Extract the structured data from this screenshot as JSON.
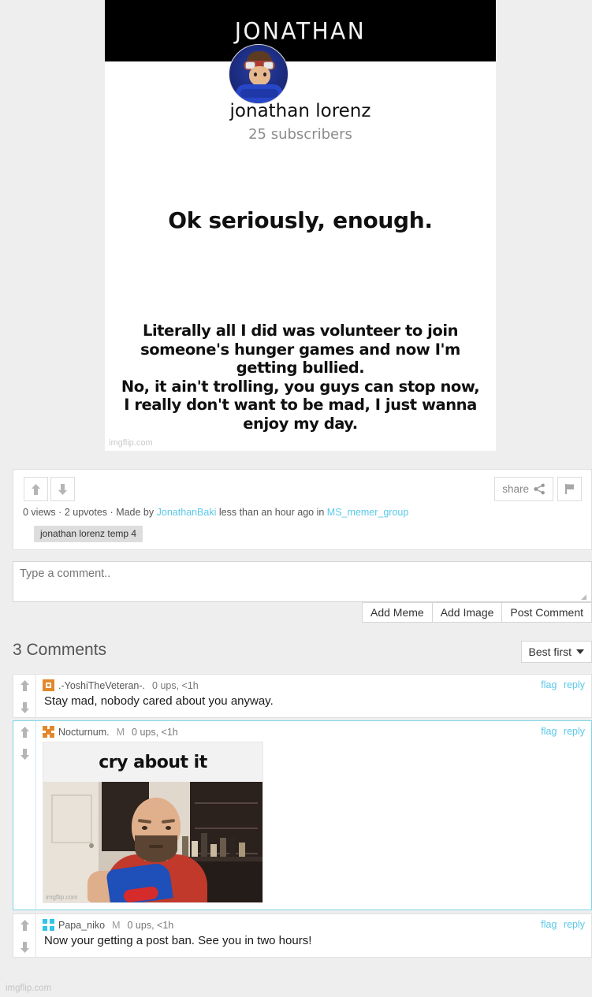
{
  "meme": {
    "banner_title": "JONATHAN",
    "channel_name": "jonathan lorenz",
    "subscribers": "25 subscribers",
    "headline": "Ok seriously, enough.",
    "body_line1": "Literally all I did was volunteer to join",
    "body_line2": "someone's hunger games and now I'm getting bullied.",
    "body_line3": "No, it ain't trolling, you guys can stop now,",
    "body_line4": "I really don't want to be mad, I just wanna enjoy my day.",
    "watermark": "imgflip.com"
  },
  "meta": {
    "views": "0 views",
    "sep1": "·",
    "upvotes": "2 upvotes",
    "sep2": "·",
    "made_by_label": "Made by",
    "author": "JonathanBaki",
    "time_text": "less than an hour ago in",
    "stream": "MS_memer_group",
    "tag": "jonathan lorenz temp 4",
    "share_label": "share",
    "upvote_icon": "arrow-up-icon",
    "downvote_icon": "arrow-down-icon",
    "share_icon": "share-nodes-icon",
    "flag_icon": "flag-icon"
  },
  "composer": {
    "placeholder": "Type a comment..",
    "value": "",
    "add_meme": "Add Meme",
    "add_image": "Add Image",
    "post_comment": "Post Comment"
  },
  "comments_header": {
    "title": "3 Comments",
    "sort_value": "Best first",
    "sort_icon": "chevron-down-icon"
  },
  "comments": [
    {
      "avatar_icon": "orange-square-avatar",
      "username": ".-YoshiTheVeteran-.",
      "mod_badge": "",
      "stats": "0 ups, <1h",
      "text": "Stay mad, nobody cared about you anyway.",
      "flag": "flag",
      "reply": "reply",
      "highlighted": false,
      "has_image": false
    },
    {
      "avatar_icon": "orange-cross-avatar",
      "username": "Nocturnum.",
      "mod_badge": "M",
      "stats": "0 ups, <1h",
      "text": "",
      "flag": "flag",
      "reply": "reply",
      "highlighted": true,
      "has_image": true,
      "image_caption": "cry about it",
      "image_watermark": "imgflip.com"
    },
    {
      "avatar_icon": "cyan-grid-avatar",
      "username": "Papa_niko",
      "mod_badge": "M",
      "stats": "0 ups, <1h",
      "text": "Now your getting a post ban. See you in two hours!",
      "flag": "flag",
      "reply": "reply",
      "highlighted": false,
      "has_image": false
    }
  ],
  "page": {
    "watermark": "imgflip.com",
    "accent_link": "#5bc8e8",
    "highlight_border": "#7ed4e8",
    "avatar_orange": "#e2882c",
    "avatar_cyan": "#31c4e8",
    "background": "#eeeeee"
  }
}
